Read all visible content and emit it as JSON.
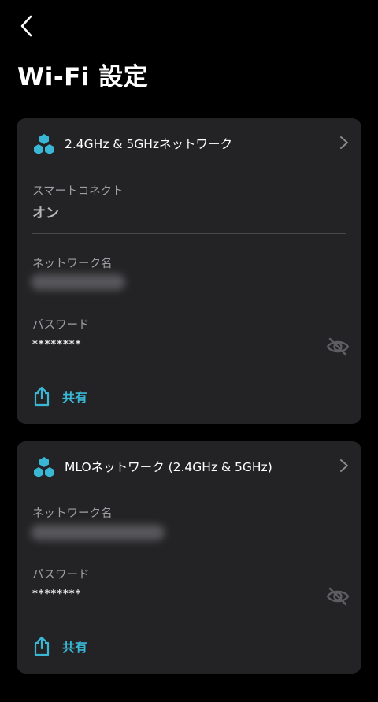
{
  "header": {
    "title": "Wi-Fi 設定",
    "back_icon": "chevron-left-icon"
  },
  "colors": {
    "background": "#000000",
    "card": "#232325",
    "accent": "#3ab7d4",
    "label": "#a0a0a4"
  },
  "networks": [
    {
      "title": "2.4GHz & 5GHzネットワーク",
      "icon": "network-nodes-icon",
      "smart_connect_label": "スマートコネクト",
      "smart_connect_value": "オン",
      "ssid_label": "ネットワーク名",
      "password_label": "パスワード",
      "password_masked": "********",
      "password_visibility_icon": "eye-off-icon",
      "share_label": "共有",
      "share_icon": "share-icon"
    },
    {
      "title": "MLOネットワーク (2.4GHz & 5GHz)",
      "icon": "network-nodes-icon",
      "ssid_label": "ネットワーク名",
      "password_label": "パスワード",
      "password_masked": "********",
      "password_visibility_icon": "eye-off-icon",
      "share_label": "共有",
      "share_icon": "share-icon"
    }
  ]
}
